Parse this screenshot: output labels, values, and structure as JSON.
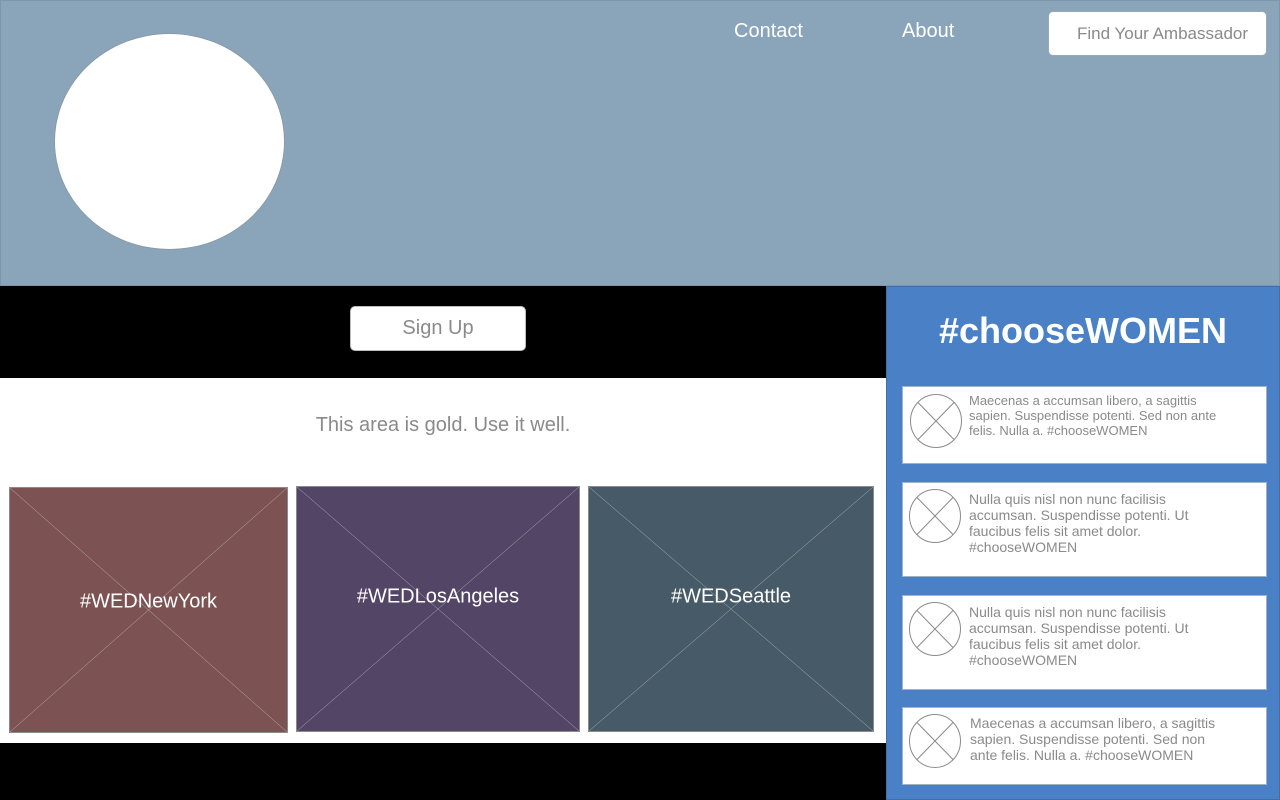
{
  "nav": {
    "contact": "Contact",
    "about": "About",
    "find_ambassador": "Find Your Ambassador"
  },
  "hero": {
    "signup_label": "Sign Up",
    "tagline": "This area is gold. Use it well."
  },
  "tiles": [
    {
      "label": "#WEDNewYork",
      "color": "#7c5352"
    },
    {
      "label": "#WEDLosAngeles",
      "color": "#534566"
    },
    {
      "label": "#WEDSeattle",
      "color": "#465b67"
    }
  ],
  "sidebar": {
    "title": "#chooseWOMEN",
    "color": "#4a80c6",
    "posts": [
      {
        "text": "Maecenas a accumsan libero, a sagittis sapien. Suspendisse potenti. Sed non ante felis. Nulla a. #chooseWOMEN"
      },
      {
        "text": "Nulla quis nisl non nunc facilisis accumsan. Suspendisse potenti. Ut faucibus felis sit amet dolor. #chooseWOMEN"
      },
      {
        "text": "Nulla quis nisl non nunc facilisis accumsan. Suspendisse potenti. Ut faucibus felis sit amet dolor. #chooseWOMEN"
      },
      {
        "text": "Maecenas a accumsan libero, a sagittis sapien. Suspendisse potenti. Sed non ante felis. Nulla a. #chooseWOMEN"
      }
    ]
  }
}
